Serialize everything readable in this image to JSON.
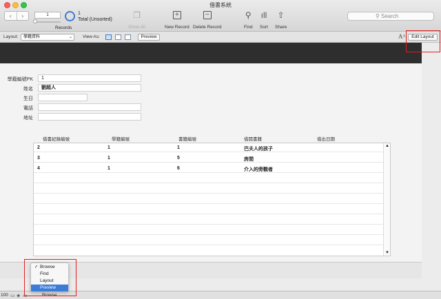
{
  "window": {
    "title": "借書系統"
  },
  "toolbar": {
    "record_number": "1",
    "found_count": "1",
    "total_label": "Total (Unsorted)",
    "records_label": "Records",
    "show_all_label": "Show All",
    "new_record_label": "New Record",
    "delete_record_label": "Delete Record",
    "find_label": "Find",
    "sort_label": "Sort",
    "share_label": "Share",
    "search_placeholder": "Search"
  },
  "layout_bar": {
    "layout_label": "Layout:",
    "layout_value": "學籍資料",
    "view_as_label": "View As:",
    "preview_label": "Preview",
    "edit_layout_label": "Edit Layout"
  },
  "form": {
    "fields": [
      {
        "label": "學籍編號PK",
        "value": "1"
      },
      {
        "label": "姓名",
        "value": "劉超人"
      },
      {
        "label": "生日",
        "value": ""
      },
      {
        "label": "電話",
        "value": ""
      },
      {
        "label": "地址",
        "value": ""
      }
    ]
  },
  "portal": {
    "columns": [
      "借書紀錄編號",
      "學籍編號",
      "書籍編號",
      "借閱書籍",
      "借出日期"
    ],
    "rows": [
      [
        "2",
        "1",
        "1",
        "巴夫人的孩子",
        ""
      ],
      [
        "3",
        "1",
        "5",
        "房間",
        ""
      ],
      [
        "4",
        "1",
        "6",
        "介入的旁觀者",
        ""
      ]
    ]
  },
  "status": {
    "zoom": "100",
    "mode": "Browse"
  },
  "mode_menu": {
    "items": [
      {
        "label": "Browse",
        "checked": true,
        "highlighted": false
      },
      {
        "label": "Find",
        "checked": false,
        "highlighted": false
      },
      {
        "label": "Layout",
        "checked": false,
        "highlighted": false
      },
      {
        "label": "Preview",
        "checked": false,
        "highlighted": true
      }
    ]
  },
  "colors": {
    "accent": "#3c7bd6",
    "header": "#2e2e2e",
    "annotation": "#e21d1d"
  }
}
